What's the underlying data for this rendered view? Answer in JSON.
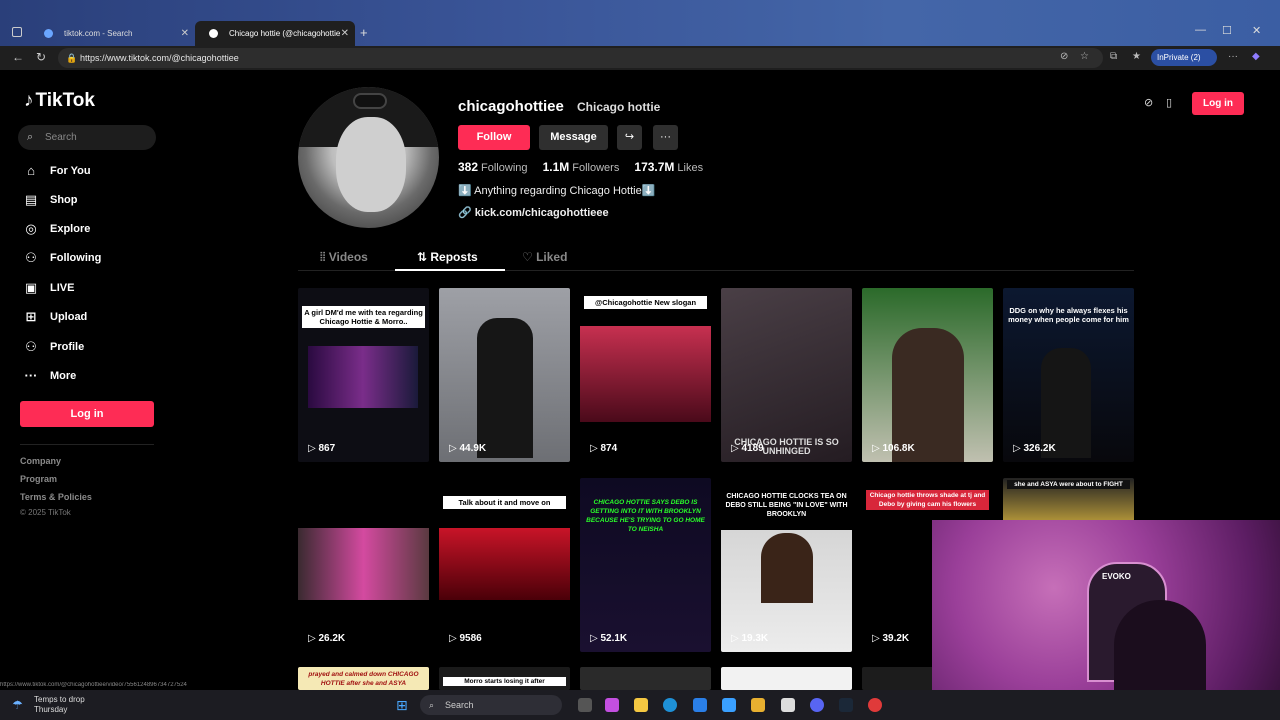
{
  "browser": {
    "tabs": [
      {
        "label": "tiktok.com - Search",
        "active": false
      },
      {
        "label": "Chicago hottie (@chicagohottie",
        "active": true
      }
    ],
    "new_tab": "+",
    "url": "https://www.tiktok.com/@chicagohottiee",
    "inprivate": "InPrivate (2)",
    "window_buttons": {
      "minimize": "—",
      "maximize": "☐",
      "close": "✕"
    }
  },
  "sidebar": {
    "logo": "TikTok",
    "search_placeholder": "Search",
    "items": [
      {
        "label": "For You",
        "icon": "home-icon",
        "glyph": "⌂"
      },
      {
        "label": "Shop",
        "icon": "shop-icon",
        "glyph": "🛍"
      },
      {
        "label": "Explore",
        "icon": "compass-icon",
        "glyph": "◎"
      },
      {
        "label": "Following",
        "icon": "person-icon",
        "glyph": "👤"
      },
      {
        "label": "LIVE",
        "icon": "live-icon",
        "glyph": "▣"
      },
      {
        "label": "Upload",
        "icon": "upload-icon",
        "glyph": "⊞"
      },
      {
        "label": "Profile",
        "icon": "profile-icon",
        "glyph": "👤"
      },
      {
        "label": "More",
        "icon": "more-icon",
        "glyph": "···"
      }
    ],
    "login": "Log in",
    "footer": [
      "Company",
      "Program",
      "Terms & Policies"
    ],
    "copyright": "© 2025 TikTok"
  },
  "profile": {
    "username": "chicagohottiee",
    "nickname": "Chicago hottie",
    "follow": "Follow",
    "message": "Message",
    "share_glyph": "↪",
    "more_glyph": "···",
    "following_count": "382",
    "following_label": "Following",
    "followers_count": "1.1M",
    "followers_label": "Followers",
    "likes_count": "173.7M",
    "likes_label": "Likes",
    "bio": "⬇️ Anything regarding Chicago Hottie⬇️",
    "link": "kick.com/chicagohottieee"
  },
  "tabs": {
    "videos": "Videos",
    "reposts": "Reposts",
    "liked": "Liked"
  },
  "topright": {
    "login": "Log in"
  },
  "grid": [
    {
      "caption": "A girl DM'd me with tea regarding Chicago Hottie & Morro..",
      "views": "867",
      "bg": "#0d0d14"
    },
    {
      "caption": "",
      "views": "44.9K",
      "bg": "#8a8c92"
    },
    {
      "caption": "@Chicagohottie New slogan",
      "views": "874",
      "bg": "#1a0e10"
    },
    {
      "caption": "CHICAGO HOTTIE IS SO UNHINGED",
      "views": "4189",
      "bg": "#3a3238"
    },
    {
      "caption": "",
      "views": "106.8K",
      "bg": "#4c5a3e"
    },
    {
      "caption": "DDG on why he always flexes his money when people come for him",
      "views": "326.2K",
      "bg": "#0c1222"
    },
    {
      "caption": "",
      "views": "26.2K",
      "bg": "#000000"
    },
    {
      "caption": "Talk about it and move on",
      "views": "9586",
      "bg": "#1a0004"
    },
    {
      "caption": "CHICAGO HOTTIE SAYS DEBO IS GETTING INTO IT WITH BROOKLYN BECAUSE HE'S TRYING TO GO HOME TO NEISHA",
      "views": "52.1K",
      "bg": "#06050e"
    },
    {
      "caption": "CHICAGO HOTTIE CLOCKS TEA ON DEBO STILL BEING \"IN LOVE\" WITH BROOKLYN",
      "views": "19.3K",
      "bg": "#cfcfcf"
    },
    {
      "caption": "Chicago hottie throws shade at tj and Debo by giving cam his flowers",
      "views": "39.2K",
      "bg": "#000000"
    },
    {
      "caption": "she and ASYA were about to FIGHT",
      "views": "",
      "bg": "#b89a3a"
    }
  ],
  "partial_row": [
    {
      "caption": "prayed and calmed down CHICAGO HOTTIE after she and ASYA",
      "bg": "#f5e9b5"
    },
    {
      "caption": "Morro starts losing it after",
      "bg": "#ffffff"
    },
    {
      "caption": "",
      "bg": "#2a2a2a"
    },
    {
      "caption": "",
      "bg": "#f2f2f2"
    },
    {
      "caption": "",
      "bg": "#1c1c1c"
    }
  ],
  "webcam": {
    "chair_brand": "EVOKO"
  },
  "taskbar": {
    "weather_line1": "Temps to drop",
    "weather_line2": "Thursday",
    "search": "Search"
  },
  "status_url": "https://www.tiktok.com/@chicagohottiee/video/7556124896734727524"
}
